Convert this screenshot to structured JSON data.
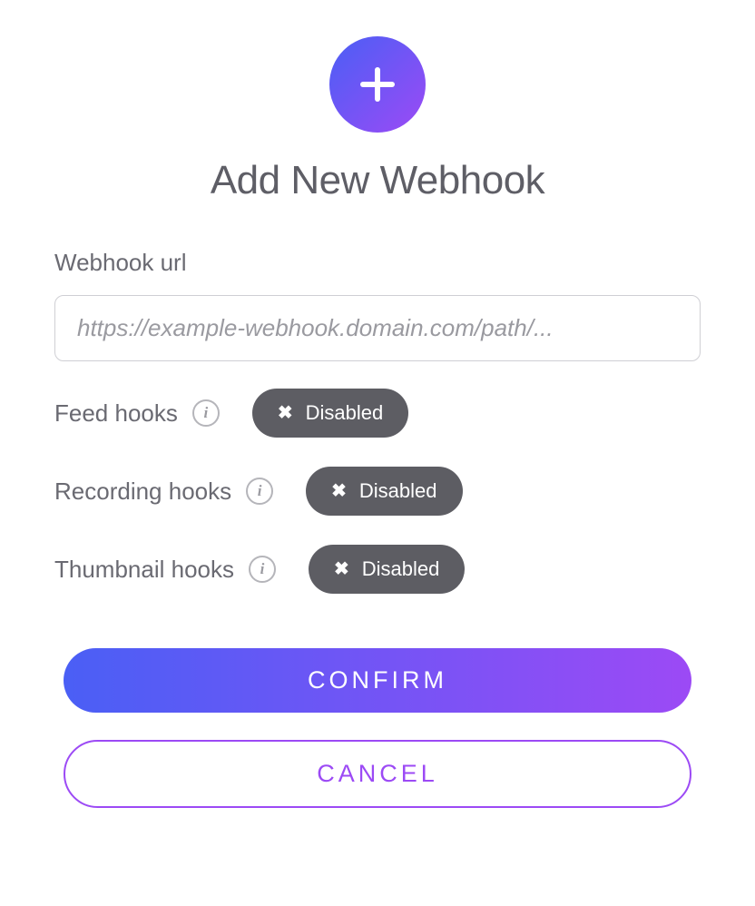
{
  "header": {
    "title": "Add New Webhook"
  },
  "form": {
    "url_label": "Webhook url",
    "url_placeholder": "https://example-webhook.domain.com/path/...",
    "url_value": ""
  },
  "hooks": {
    "feed": {
      "label": "Feed hooks",
      "status": "Disabled"
    },
    "recording": {
      "label": "Recording hooks",
      "status": "Disabled"
    },
    "thumbnail": {
      "label": "Thumbnail hooks",
      "status": "Disabled"
    }
  },
  "buttons": {
    "confirm": "CONFIRM",
    "cancel": "CANCEL"
  },
  "info_glyph": "i"
}
